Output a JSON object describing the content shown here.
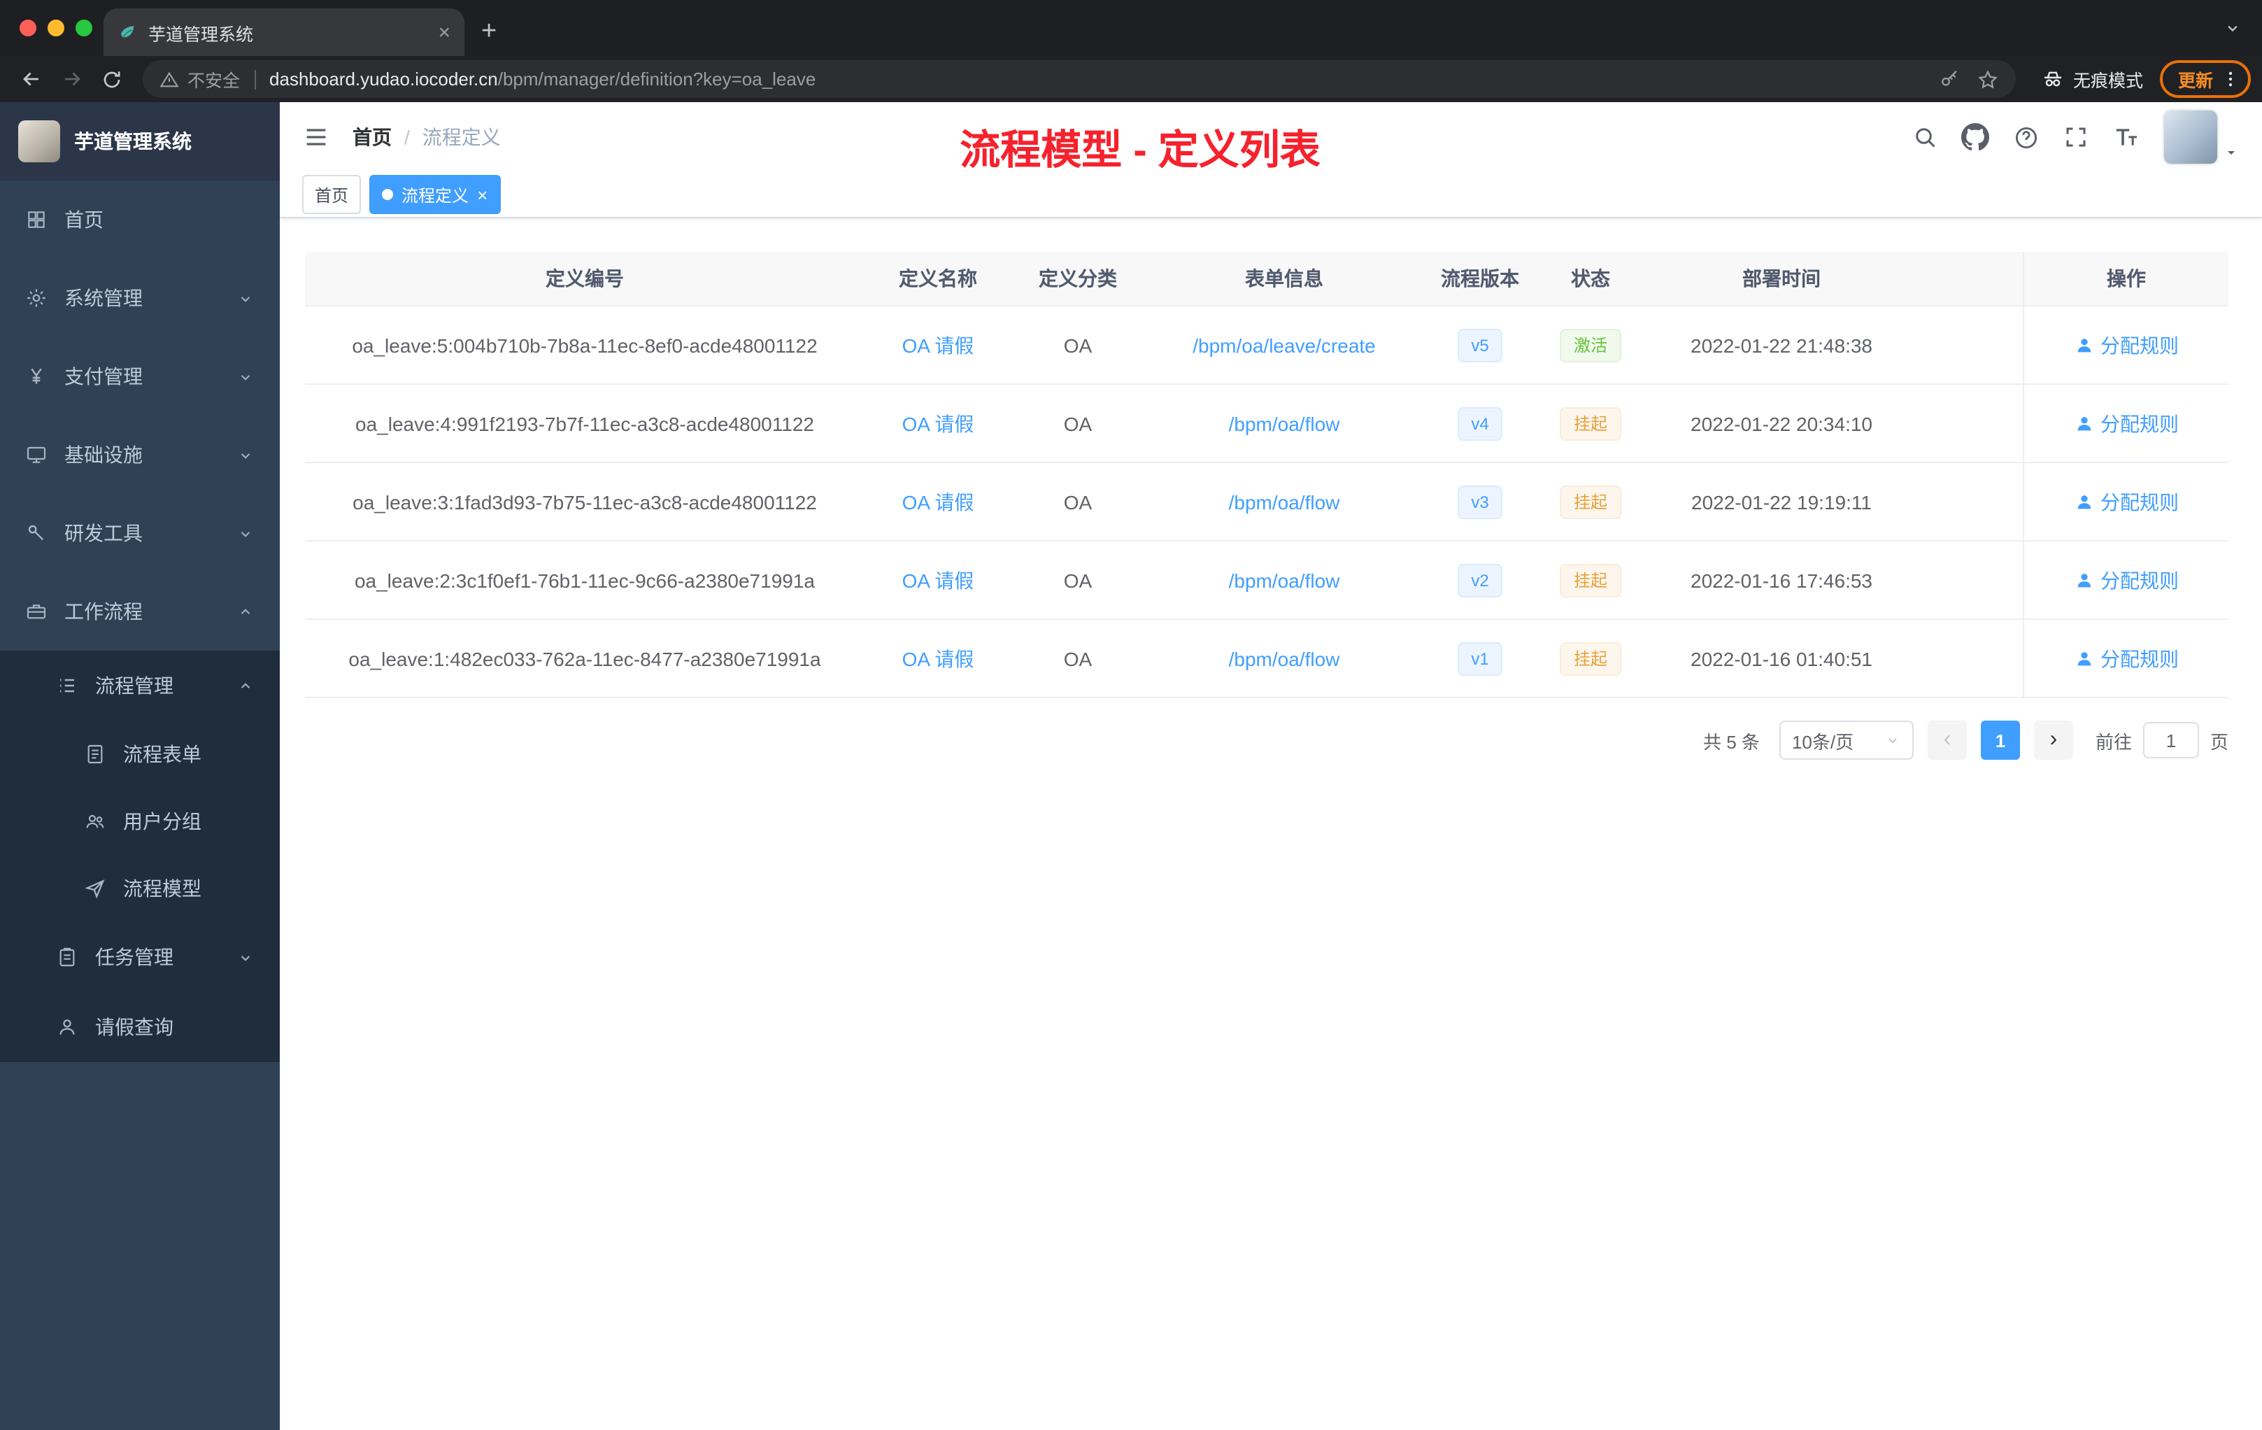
{
  "browser": {
    "tab": {
      "title": "芋道管理系统"
    },
    "address": {
      "security_label": "不安全",
      "host": "dashboard.yudao.iocoder.cn",
      "path": "/bpm/manager/definition?key=oa_leave"
    },
    "incognito_label": "无痕模式",
    "update_label": "更新"
  },
  "sidebar": {
    "logo_title": "芋道管理系统",
    "items": [
      {
        "label": "首页",
        "icon": "dashboard-icon",
        "level": 0
      },
      {
        "label": "系统管理",
        "icon": "gear-icon",
        "level": 0,
        "chevron": "down"
      },
      {
        "label": "支付管理",
        "icon": "payment-icon",
        "level": 0,
        "chevron": "down"
      },
      {
        "label": "基础设施",
        "icon": "infrastructure-icon",
        "level": 0,
        "chevron": "down"
      },
      {
        "label": "研发工具",
        "icon": "devtools-icon",
        "level": 0,
        "chevron": "down"
      },
      {
        "label": "工作流程",
        "icon": "workflow-icon",
        "level": 0,
        "chevron": "up"
      },
      {
        "label": "流程管理",
        "icon": "process-manage-icon",
        "level": 1,
        "chevron": "up"
      },
      {
        "label": "流程表单",
        "icon": "form-icon",
        "level": 2
      },
      {
        "label": "用户分组",
        "icon": "user-group-icon",
        "level": 2
      },
      {
        "label": "流程模型",
        "icon": "model-icon",
        "level": 2
      },
      {
        "label": "任务管理",
        "icon": "task-icon",
        "level": 1,
        "chevron": "down"
      },
      {
        "label": "请假查询",
        "icon": "leave-icon",
        "level": 1
      }
    ]
  },
  "navbar": {
    "breadcrumb": {
      "home": "首页",
      "separator": "/",
      "current": "流程定义"
    },
    "annotation": "流程模型 - 定义列表"
  },
  "tags": {
    "items": [
      {
        "label": "首页",
        "active": false
      },
      {
        "label": "流程定义",
        "active": true
      }
    ]
  },
  "table": {
    "columns": [
      "定义编号",
      "定义名称",
      "定义分类",
      "表单信息",
      "流程版本",
      "状态",
      "部署时间",
      "操作"
    ],
    "rows": [
      {
        "id": "oa_leave:5:004b710b-7b8a-11ec-8ef0-acde48001122",
        "name": "OA 请假",
        "category": "OA",
        "form": "/bpm/oa/leave/create",
        "version": "v5",
        "status": "激活",
        "status_type": "success",
        "time": "2022-01-22 21:48:38",
        "action": "分配规则"
      },
      {
        "id": "oa_leave:4:991f2193-7b7f-11ec-a3c8-acde48001122",
        "name": "OA 请假",
        "category": "OA",
        "form": "/bpm/oa/flow",
        "version": "v4",
        "status": "挂起",
        "status_type": "warning",
        "time": "2022-01-22 20:34:10",
        "action": "分配规则"
      },
      {
        "id": "oa_leave:3:1fad3d93-7b75-11ec-a3c8-acde48001122",
        "name": "OA 请假",
        "category": "OA",
        "form": "/bpm/oa/flow",
        "version": "v3",
        "status": "挂起",
        "status_type": "warning",
        "time": "2022-01-22 19:19:11",
        "action": "分配规则"
      },
      {
        "id": "oa_leave:2:3c1f0ef1-76b1-11ec-9c66-a2380e71991a",
        "name": "OA 请假",
        "category": "OA",
        "form": "/bpm/oa/flow",
        "version": "v2",
        "status": "挂起",
        "status_type": "warning",
        "time": "2022-01-16 17:46:53",
        "action": "分配规则"
      },
      {
        "id": "oa_leave:1:482ec033-762a-11ec-8477-a2380e71991a",
        "name": "OA 请假",
        "category": "OA",
        "form": "/bpm/oa/flow",
        "version": "v1",
        "status": "挂起",
        "status_type": "warning",
        "time": "2022-01-16 01:40:51",
        "action": "分配规则"
      }
    ]
  },
  "pagination": {
    "total": "共 5 条",
    "page_size": "10条/页",
    "current_page": "1",
    "goto_label": "前往",
    "goto_value": "1",
    "unit_label": "页"
  },
  "glyphs": {
    "close": "×",
    "plus": "+",
    "prev": "‹",
    "next": "›"
  }
}
